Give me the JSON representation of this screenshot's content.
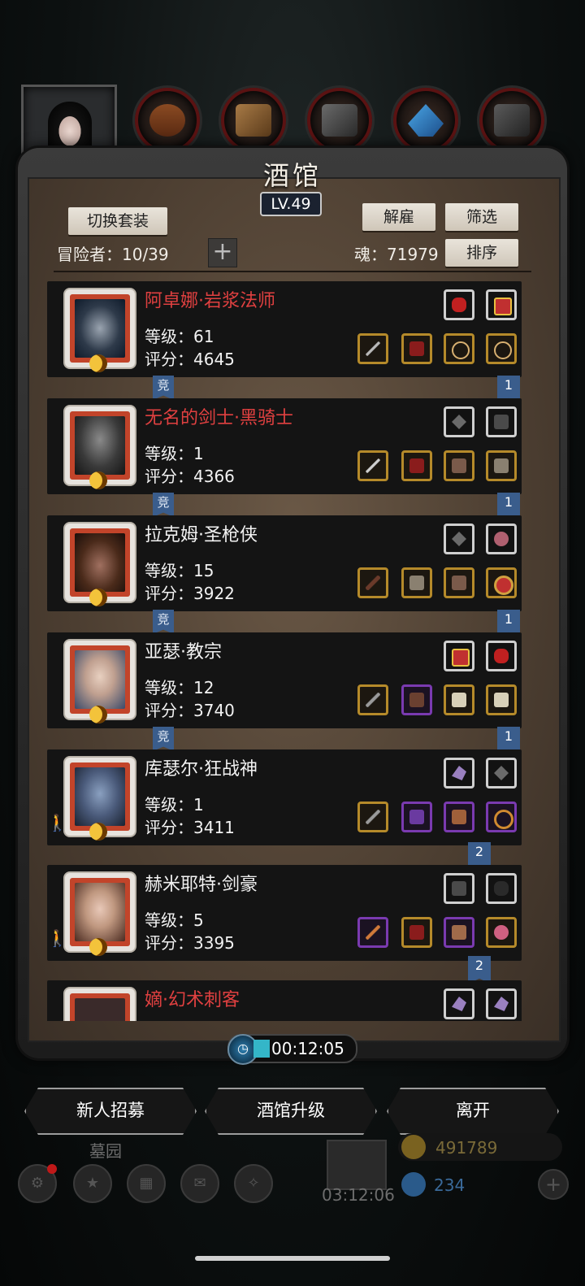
{
  "title": "酒馆",
  "level": "LV.49",
  "buttons": {
    "switch_outfit": "切换套装",
    "dismiss": "解雇",
    "filter": "筛选",
    "sort": "排序",
    "recruit": "新人招募",
    "upgrade": "酒馆升级",
    "leave": "离开"
  },
  "header": {
    "adventurers": "冒险者：10/39",
    "soul": "魂：71979"
  },
  "timer": "00:12:05",
  "heroes": [
    {
      "name": "阿卓娜·岩浆法师",
      "level": "等级：61",
      "score": "评分：4645",
      "rare": true,
      "comp": "竞",
      "rank": "1",
      "walker": false
    },
    {
      "name": "无名的剑士·黑骑士",
      "level": "等级：1",
      "score": "评分：4366",
      "rare": true,
      "comp": "竞",
      "rank": "1",
      "walker": false
    },
    {
      "name": "拉克姆·圣枪侠",
      "level": "等级：15",
      "score": "评分：3922",
      "rare": false,
      "comp": "竞",
      "rank": "1",
      "walker": false
    },
    {
      "name": "亚瑟·教宗",
      "level": "等级：12",
      "score": "评分：3740",
      "rare": false,
      "comp": "竞",
      "rank": "1",
      "walker": false
    },
    {
      "name": "库瑟尔·狂战神",
      "level": "等级：1",
      "score": "评分：3411",
      "rare": false,
      "comp": "",
      "rank": "2",
      "walker": true
    },
    {
      "name": "赫米耶特·剑豪",
      "level": "等级：5",
      "score": "评分：3395",
      "rare": false,
      "comp": "",
      "rank": "2",
      "walker": true
    },
    {
      "name": "嫡·幻术刺客",
      "level": "",
      "score": "",
      "rare": true,
      "comp": "",
      "rank": "",
      "walker": false
    }
  ],
  "footer": {
    "area": "墓园",
    "countdown": "03:12:06",
    "gold": "491789",
    "gems": "234"
  }
}
